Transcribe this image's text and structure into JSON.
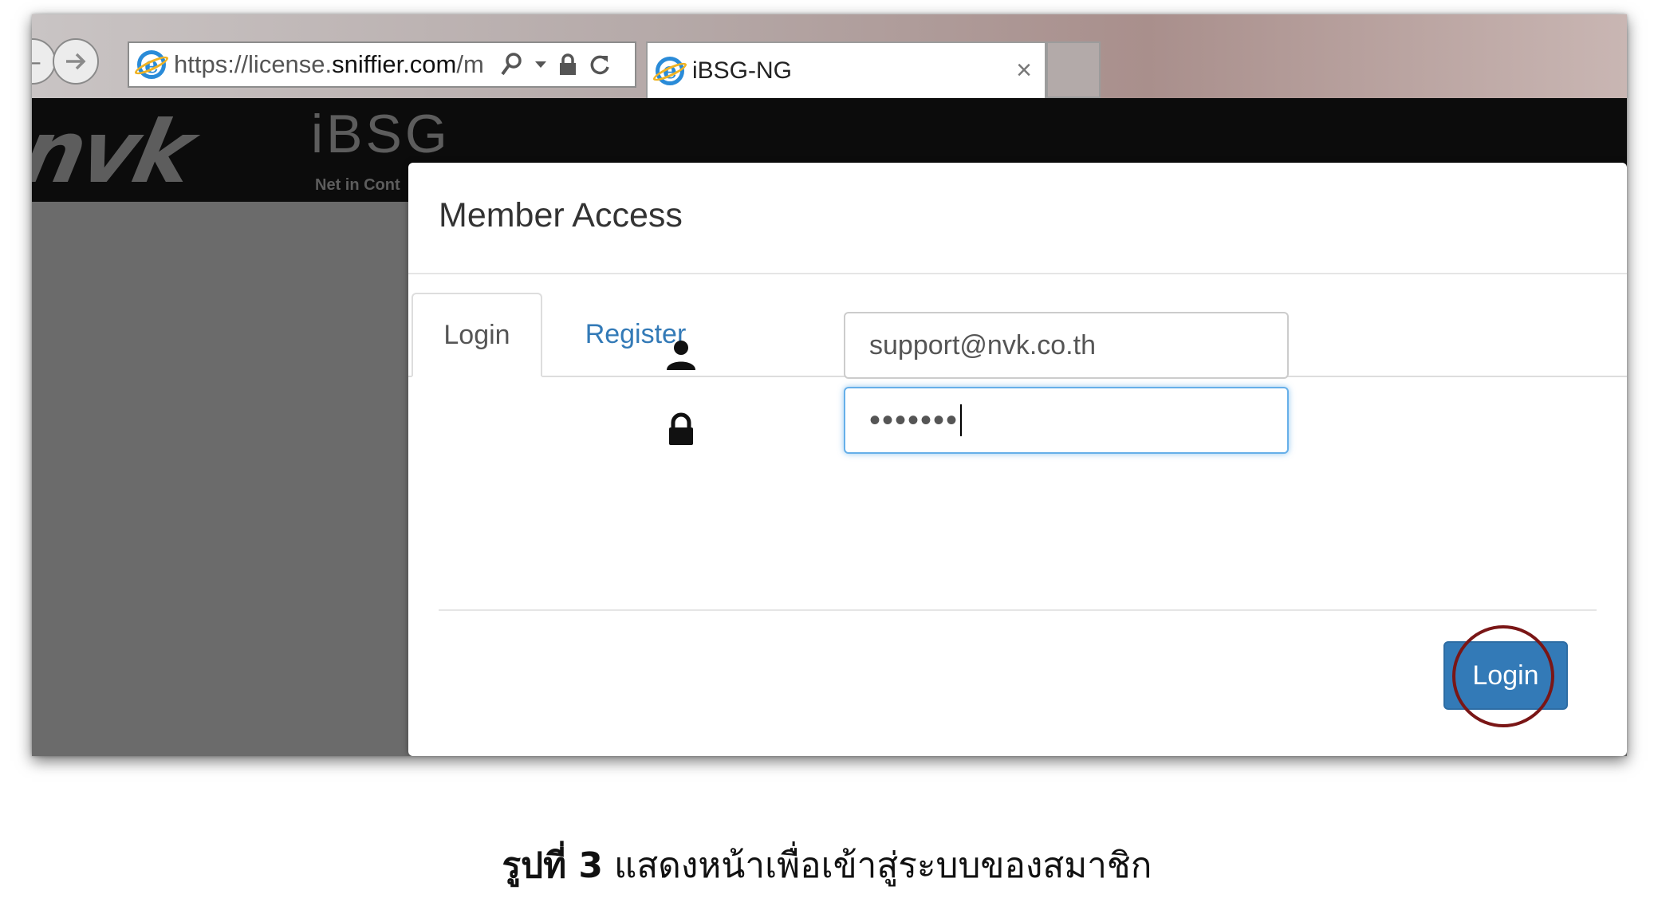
{
  "browser": {
    "url_scheme": "https://",
    "url_host_pre": "license.",
    "url_host": "sniffier.com",
    "url_path": "/m",
    "tab_title": "iBSG-NG",
    "tab_close": "×"
  },
  "header": {
    "logo": "nvk",
    "product": "iBSG",
    "tagline": "Net in Cont"
  },
  "modal": {
    "title": "Member Access",
    "tabs": [
      {
        "label": "Login",
        "active": true
      },
      {
        "label": "Register",
        "active": false
      }
    ],
    "email_value": "support@nvk.co.th",
    "password_mask": "•••••••",
    "submit_label": "Login"
  },
  "caption": {
    "bold": "รูปที่ 3",
    "text": " แสดงหน้าเพื่อเข้าสู่ระบบของสมาชิก"
  },
  "colors": {
    "primary": "#337ab7",
    "link": "#337ab7",
    "header_bg": "#0c0c0c",
    "highlight_circle": "#7a1616",
    "focus": "#66afe9"
  },
  "icons": [
    "back-icon",
    "forward-icon",
    "ie-icon",
    "search-icon",
    "dropdown-icon",
    "lock-icon",
    "refresh-icon",
    "close-icon",
    "user-icon",
    "padlock-icon"
  ]
}
